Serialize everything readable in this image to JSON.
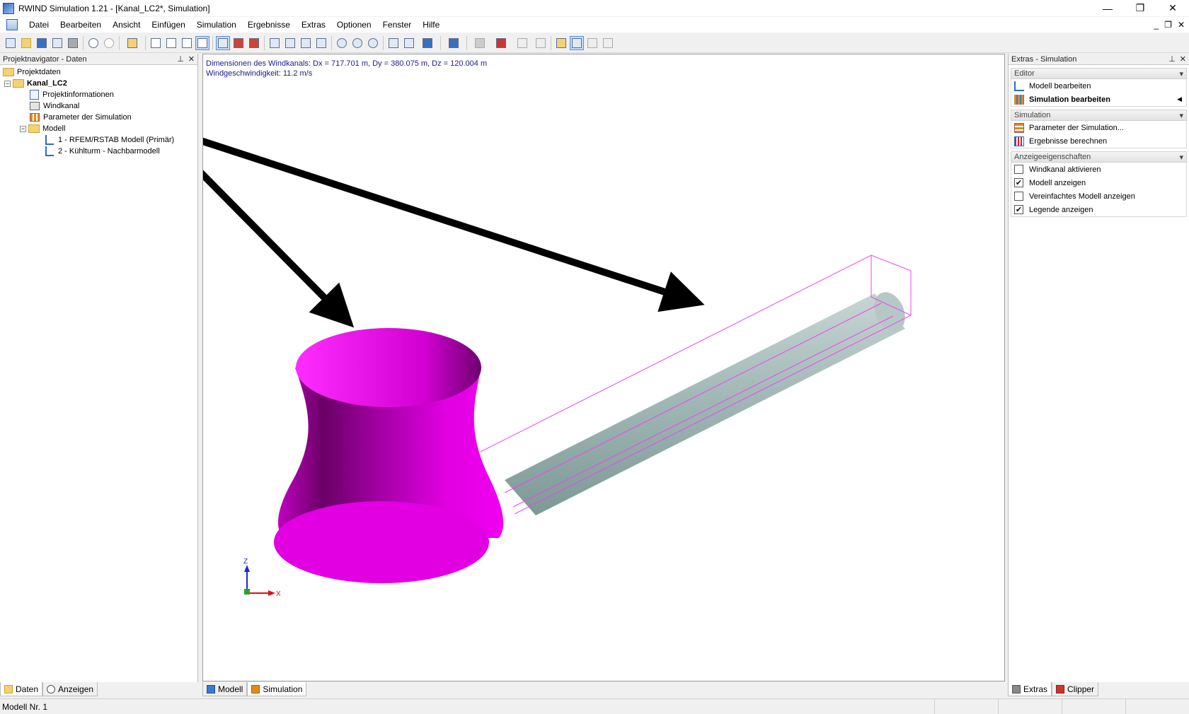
{
  "window": {
    "title": "RWIND Simulation 1.21 - [Kanal_LC2*, Simulation]",
    "minimize": "—",
    "restore": "❐",
    "close": "✕"
  },
  "menu": {
    "items": [
      "Datei",
      "Bearbeiten",
      "Ansicht",
      "Einfügen",
      "Simulation",
      "Ergebnisse",
      "Extras",
      "Optionen",
      "Fenster",
      "Hilfe"
    ],
    "mdi_minimize": "_",
    "mdi_restore": "❐",
    "mdi_close": "✕"
  },
  "left_panel": {
    "title": "Projektnavigator - Daten",
    "pin": "⊥",
    "close": "✕",
    "tree": {
      "root": "Projektdaten",
      "project": "Kanal_LC2",
      "info": "Projektinformationen",
      "windkanal": "Windkanal",
      "params": "Parameter der Simulation",
      "modell": "Modell",
      "model1": "1 - RFEM/RSTAB Modell (Primär)",
      "model2": "2 - Kühlturm - Nachbarmodell"
    },
    "tabs": [
      "Daten",
      "Anzeigen"
    ]
  },
  "viewport": {
    "line1": "Dimensionen des Windkanals: Dx = 717.701 m, Dy = 380.075 m, Dz = 120.004 m",
    "line2": "Windgeschwindigkeit: 11.2 m/s",
    "axis_z": "Z",
    "axis_x": "X",
    "colors": {
      "tower": "#e200e2",
      "pipe": "#9fb6b4",
      "box": "#ee44ee",
      "arrow": "#000000"
    }
  },
  "main_tabs": [
    "Modell",
    "Simulation"
  ],
  "right_panel": {
    "title": "Extras - Simulation",
    "pin": "⊥",
    "close": "✕",
    "editor": {
      "header": "Editor",
      "items": [
        "Modell bearbeiten",
        "Simulation bearbeiten"
      ]
    },
    "simulation": {
      "header": "Simulation",
      "items": [
        "Parameter der Simulation...",
        "Ergebnisse berechnen"
      ]
    },
    "display": {
      "header": "Anzeigeeigenschaften",
      "items": [
        {
          "label": "Windkanal aktivieren",
          "checked": false
        },
        {
          "label": "Modell anzeigen",
          "checked": true
        },
        {
          "label": "Vereinfachtes Modell anzeigen",
          "checked": false
        },
        {
          "label": "Legende anzeigen",
          "checked": true
        }
      ]
    },
    "tabs": [
      "Extras",
      "Clipper"
    ]
  },
  "status": {
    "text": "Modell Nr. 1"
  }
}
